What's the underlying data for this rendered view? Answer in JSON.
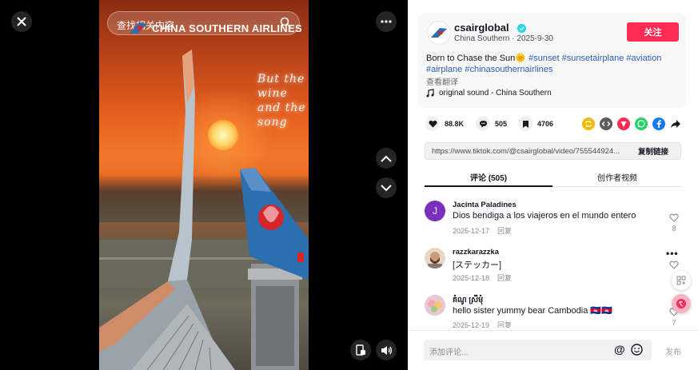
{
  "viewer": {
    "search_placeholder": "查找相关内容",
    "brand_text": "CHINA SOUTHERN AIRLINES",
    "lyric_line1": "But the wine",
    "lyric_line2": "and the song"
  },
  "post": {
    "username": "csairglobal",
    "subline": "China Southern · 2025-9-30",
    "follow_label": "关注",
    "desc_text": "Born to Chase the Sun",
    "desc_emoji": "🌞",
    "hashtags": [
      "#sunset",
      "#sunsetairplane",
      "#aviation",
      "#airplane",
      "#chinasouthernairlines"
    ],
    "translate_label": "查看翻译",
    "music_label": "original sound - China Southern"
  },
  "stats": {
    "likes": "88.8K",
    "comments": "505",
    "saves": "4706"
  },
  "share_colors": {
    "repost": "#f5b900",
    "embed": "#5c5c5c",
    "send": "#fe2c55",
    "whatsapp": "#25d366",
    "facebook": "#1877f2"
  },
  "link": {
    "url": "https://www.tiktok.com/@csairglobal/video/755544924...",
    "copy_label": "复制链接"
  },
  "tabs": {
    "comments_label": "评论 (505)",
    "creator_label": "创作者视频"
  },
  "comments": [
    {
      "name": "Jacinta Paladines",
      "text": "Dios bendiga a los viajeros en el mundo entero",
      "date": "2025-12-17",
      "reply": "回复",
      "likes": "8",
      "avatar_letter": "J"
    },
    {
      "name": "razzkarazzka",
      "text": "[ステッカー]",
      "date": "2025-12-18",
      "reply": "回复",
      "likes": ""
    },
    {
      "name": "គំណូ ស្រីមុំ",
      "text": "hello sister yummy bear Cambodia 🇰🇭🇰🇭",
      "date": "2025-12-19",
      "reply": "回复",
      "likes": "7"
    }
  ],
  "bottom": {
    "input_placeholder": "添加评论...",
    "at_label": "@",
    "post_label": "发布"
  }
}
